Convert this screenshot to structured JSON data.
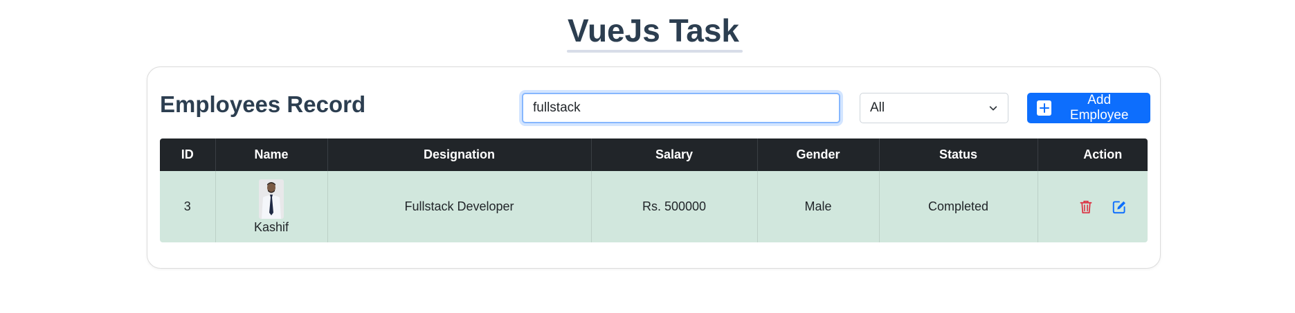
{
  "page": {
    "title": "VueJs Task"
  },
  "card": {
    "heading": "Employees Record",
    "search": {
      "value": "fullstack",
      "placeholder": ""
    },
    "filter": {
      "selected": "All"
    },
    "add_button": {
      "label": "Add Employee"
    }
  },
  "table": {
    "headers": [
      "ID",
      "Name",
      "Designation",
      "Salary",
      "Gender",
      "Status",
      "Action"
    ],
    "rows": [
      {
        "id": "3",
        "name": "Kashif",
        "designation": "Fullstack Developer",
        "salary": "Rs. 500000",
        "gender": "Male",
        "status": "Completed",
        "actions": [
          "trash-icon",
          "edit-icon"
        ]
      }
    ]
  },
  "colors": {
    "primary": "#0d6efd",
    "header_bg": "#212529",
    "row_success_bg": "#d1e7dd",
    "delete": "#dc3545",
    "title": "#2c3e50"
  }
}
